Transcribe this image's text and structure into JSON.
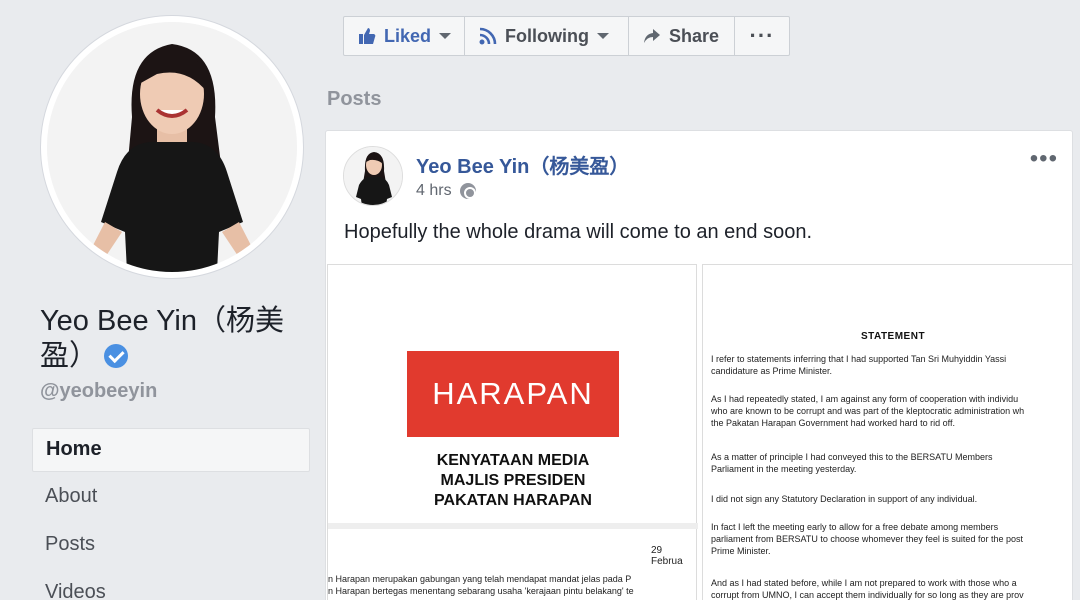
{
  "profile": {
    "name": "Yeo Bee Yin（杨美盈）",
    "handle": "@yeobeeyin",
    "verified_icon": "verified-badge-icon"
  },
  "nav": {
    "items": [
      {
        "label": "Home",
        "active": true
      },
      {
        "label": "About",
        "active": false
      },
      {
        "label": "Posts",
        "active": false
      },
      {
        "label": "Videos",
        "active": false
      }
    ]
  },
  "actions": {
    "liked_label": "Liked",
    "following_label": "Following",
    "share_label": "Share",
    "more_label": "···"
  },
  "posts_heading": "Posts",
  "post": {
    "author": "Yeo Bee Yin（杨美盈）",
    "time": "4 hrs",
    "menu": "•••",
    "text": "Hopefully the whole drama will come to an end soon.",
    "doc_left": {
      "logo": "HARAPAN",
      "lines": [
        "KENYATAAN MEDIA",
        "MAJLIS PRESIDEN",
        "PAKATAN HARAPAN"
      ],
      "date": "29 Februa",
      "body": [
        "n Harapan merupakan gabungan yang telah mendapat mandat jelas pada P",
        "n Harapan bertegas menentang sebarang usaha 'kerajaan pintu belakang' te"
      ]
    },
    "doc_right": {
      "title": "STATEMENT",
      "paragraphs": [
        [
          "I refer to statements inferring that I had supported Tan Sri Muhyiddin Yassi",
          "candidature as Prime Minister."
        ],
        [
          "As I had repeatedly stated, I am against any form of cooperation with individu",
          "who are known to be corrupt and was part of the kleptocratic administration wh",
          "the Pakatan Harapan Government had worked hard to rid off."
        ],
        [
          "As a matter of principle I had conveyed this to the BERSATU Members",
          "Parliament in the meeting yesterday."
        ],
        [
          "I did not sign any Statutory Declaration in support of any individual."
        ],
        [
          "In fact I left the meeting early to allow for a free debate among members",
          "parliament from BERSATU to choose whomever they feel is suited for the post",
          "Prime Minister."
        ],
        [
          "And as I had stated before, while I am not prepared to work with those who a",
          "corrupt from UMNO, I can accept them individually for so long as they are prov"
        ]
      ]
    }
  },
  "colors": {
    "brand_link": "#365899",
    "liked": "#4267b2",
    "harapan_red": "#e13a2e",
    "page_bg": "#e9ebee"
  }
}
